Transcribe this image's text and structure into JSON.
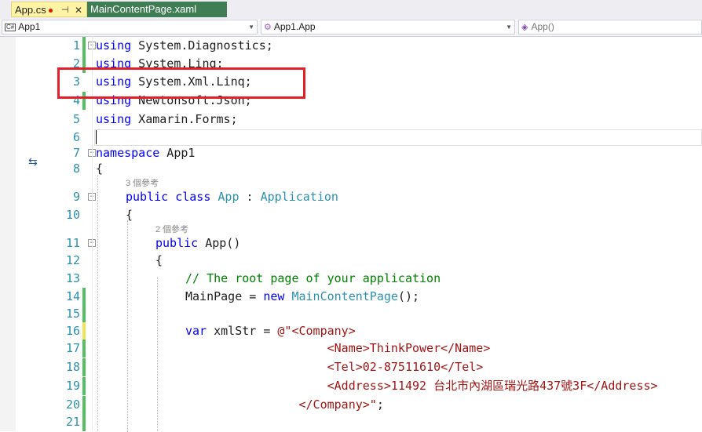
{
  "tabs": [
    {
      "label": "App.cs",
      "modified": true,
      "pin_glyph": "⊣",
      "close_glyph": "✕"
    },
    {
      "label": "MainContentPage.xaml"
    }
  ],
  "navbar": {
    "project": "App1",
    "project_icon": "C#",
    "type": "App1.App",
    "member": "App()"
  },
  "code_lines": [
    {
      "n": "1",
      "change": "green",
      "fold": "⊟",
      "indent": 0,
      "tokens": [
        [
          "kw",
          "using"
        ],
        [
          "",
          "System.Diagnostics;"
        ]
      ]
    },
    {
      "n": "2",
      "change": "green",
      "fold": "",
      "indent": 0,
      "tokens": [
        [
          "kw",
          "using"
        ],
        [
          "",
          "System.Linq;"
        ]
      ]
    },
    {
      "n": "3",
      "change": "",
      "fold": "",
      "indent": 0,
      "tokens": [
        [
          "kw",
          "using"
        ],
        [
          "",
          "System.Xml.Linq;"
        ]
      ]
    },
    {
      "n": "4",
      "change": "green",
      "fold": "",
      "indent": 0,
      "tokens": [
        [
          "kw",
          "using"
        ],
        [
          "",
          "Newtonsoft.Json;"
        ]
      ]
    },
    {
      "n": "5",
      "change": "",
      "fold": "",
      "indent": 0,
      "tokens": [
        [
          "kw",
          "using"
        ],
        [
          "",
          "Xamarin.Forms;"
        ]
      ]
    },
    {
      "n": "6",
      "change": "",
      "fold": "",
      "indent": 0,
      "tokens": []
    },
    {
      "n": "7",
      "change": "",
      "fold": "⊟",
      "indent": 0,
      "tokens": [
        [
          "kw",
          "namespace"
        ],
        [
          "",
          "App1"
        ]
      ]
    },
    {
      "n": "8",
      "change": "",
      "fold": "",
      "indent": 0,
      "tokens": [
        [
          "",
          "{"
        ]
      ]
    },
    {
      "n": "9",
      "change": "",
      "fold": "⊟",
      "indent": 1,
      "refs": "3 個參考",
      "tokens": [
        [
          "kw",
          "public"
        ],
        [
          "kw",
          "class"
        ],
        [
          "ty",
          "App"
        ],
        [
          "",
          ":"
        ],
        [
          "ty",
          "Application"
        ]
      ]
    },
    {
      "n": "10",
      "change": "",
      "fold": "",
      "indent": 1,
      "tokens": [
        [
          "",
          "{"
        ]
      ]
    },
    {
      "n": "11",
      "change": "",
      "fold": "⊟",
      "indent": 2,
      "refs": "2 個參考",
      "tokens": [
        [
          "kw",
          "public"
        ],
        [
          "",
          "App()"
        ]
      ]
    },
    {
      "n": "12",
      "change": "",
      "fold": "",
      "indent": 2,
      "tokens": [
        [
          "",
          "{"
        ]
      ]
    },
    {
      "n": "13",
      "change": "",
      "fold": "",
      "indent": 3,
      "tokens": [
        [
          "cm",
          "// The root page of your application"
        ]
      ]
    },
    {
      "n": "14",
      "change": "green",
      "fold": "",
      "indent": 3,
      "tokens": [
        [
          "",
          "MainPage = "
        ],
        [
          "kw",
          "new"
        ],
        [
          "ty",
          "MainContentPage"
        ],
        [
          "",
          "();"
        ]
      ]
    },
    {
      "n": "15",
      "change": "green",
      "fold": "",
      "indent": 3,
      "tokens": []
    },
    {
      "n": "16",
      "change": "yellow",
      "fold": "",
      "indent": 3,
      "tokens": [
        [
          "kw",
          "var"
        ],
        [
          "",
          "xmlStr = "
        ],
        [
          "st",
          "@\"<Company>"
        ]
      ]
    },
    {
      "n": "17",
      "change": "green",
      "fold": "",
      "indent": 3,
      "tokens": [
        [
          "st",
          "                    <Name>ThinkPower</Name>"
        ]
      ]
    },
    {
      "n": "18",
      "change": "green",
      "fold": "",
      "indent": 3,
      "tokens": [
        [
          "st",
          "                    <Tel>02-87511610</Tel>"
        ]
      ]
    },
    {
      "n": "19",
      "change": "green",
      "fold": "",
      "indent": 3,
      "tokens": [
        [
          "st",
          "                    <Address>11492 台北市內湖區瑞光路437號3F</Address>"
        ]
      ]
    },
    {
      "n": "20",
      "change": "green",
      "fold": "",
      "indent": 3,
      "tokens": [
        [
          "st",
          "                </Company>\""
        ],
        [
          "",
          ";"
        ]
      ]
    },
    {
      "n": "21",
      "change": "green",
      "fold": "",
      "indent": 3,
      "tokens": []
    }
  ],
  "colors": {
    "keyword": "#0000ff",
    "type": "#2b91af",
    "comment": "#008000",
    "string": "#a31515",
    "highlight_box": "#e3202a"
  }
}
